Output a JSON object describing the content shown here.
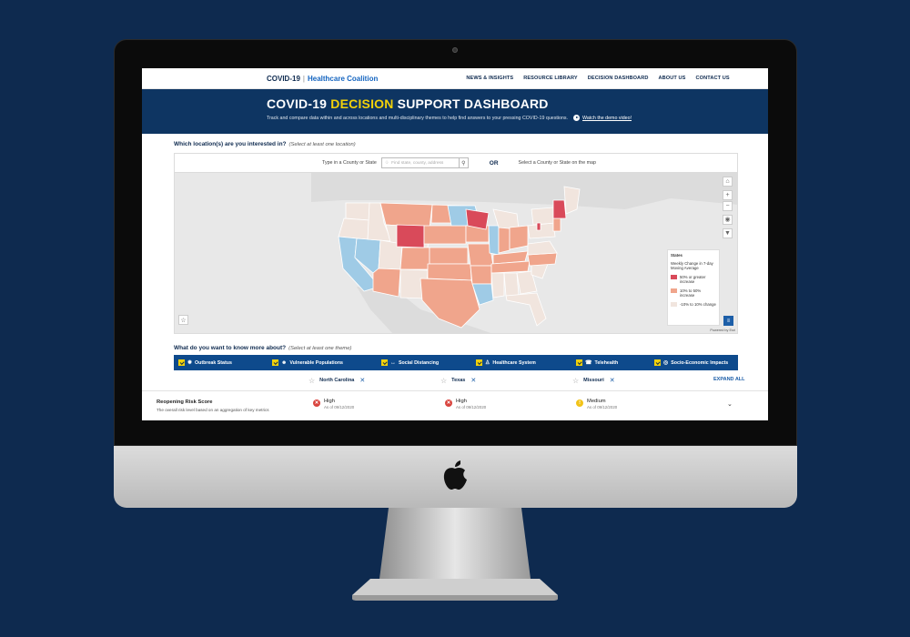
{
  "nav": {
    "brand_main": "COVID-19",
    "brand_sub": "Healthcare Coalition",
    "links": [
      "NEWS & INSIGHTS",
      "RESOURCE LIBRARY",
      "DECISION DASHBOARD",
      "ABOUT US",
      "CONTACT US"
    ]
  },
  "hero": {
    "title_pre": "COVID-19",
    "title_highlight": "DECISION",
    "title_post": "SUPPORT DASHBOARD",
    "description": "Track and compare data within and across locations and multi-disciplinary themes to help find answers to your pressing COVID-19 questions.",
    "video_link": "Watch the demo video!"
  },
  "location_section": {
    "question": "Which location(s) are you interested in?",
    "hint": "(Select at least one location)",
    "search_label": "Type in a County or State",
    "search_placeholder": "Find state, county, address",
    "or_label": "OR",
    "map_label": "Select a County or State on the map"
  },
  "map": {
    "legend_title": "States",
    "legend_subtitle": "Weekly Change in 7-day Moving Average",
    "legend_items": [
      {
        "label": "50% or greater increase",
        "color": "#d94a5a"
      },
      {
        "label": "10% to 50% increase",
        "color": "#f0a58c"
      },
      {
        "label": "-10% to 10% change",
        "color": "#f1e5de"
      }
    ],
    "powered_by": "Powered by Esri",
    "colors": {
      "high": "#d94a5a",
      "mid": "#f0a58c",
      "low": "#f1e5de",
      "decrease": "#9fcbe6",
      "other": "#dedede"
    }
  },
  "theme_section": {
    "question": "What do you want to know more about?",
    "hint": "(Select at least one theme)",
    "themes": [
      {
        "label": "Outbreak Status",
        "icon": "virus-icon"
      },
      {
        "label": "Vulnerable Populations",
        "icon": "people-icon"
      },
      {
        "label": "Social Distancing",
        "icon": "distancing-icon"
      },
      {
        "label": "Healthcare System",
        "icon": "doctor-icon"
      },
      {
        "label": "Telehealth",
        "icon": "phone-icon"
      },
      {
        "label": "Socio-Economic Impacts",
        "icon": "globe-icon"
      }
    ]
  },
  "locations": [
    "North Carolina",
    "Texas",
    "Missouri"
  ],
  "expand_all": "EXPAND ALL",
  "risk": {
    "title": "Reopening Risk Score",
    "subtitle": "The overall risk level based on an aggregation of key metrics",
    "cells": [
      {
        "level": "High",
        "as_of": "As of 09/12/2020",
        "color": "#d9453f",
        "icon": "x-icon"
      },
      {
        "level": "High",
        "as_of": "As of 09/12/2020",
        "color": "#d9453f",
        "icon": "x-icon"
      },
      {
        "level": "Medium",
        "as_of": "As of 09/12/2020",
        "color": "#f2c318",
        "icon": "warning-icon"
      }
    ]
  }
}
